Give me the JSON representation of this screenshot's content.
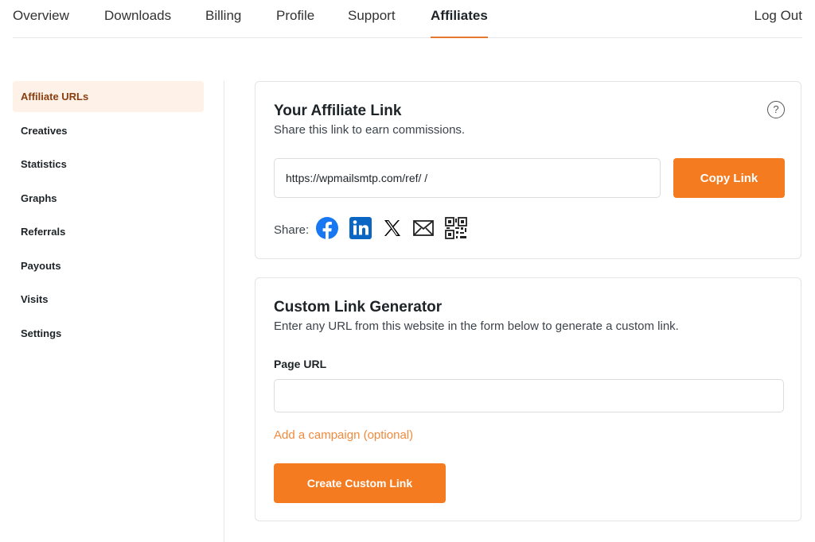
{
  "topnav": {
    "tabs": [
      {
        "label": "Overview"
      },
      {
        "label": "Downloads"
      },
      {
        "label": "Billing"
      },
      {
        "label": "Profile"
      },
      {
        "label": "Support"
      },
      {
        "label": "Affiliates",
        "active": true
      }
    ],
    "logout_label": "Log Out"
  },
  "sidebar": {
    "items": [
      {
        "label": "Affiliate URLs",
        "active": true
      },
      {
        "label": "Creatives"
      },
      {
        "label": "Statistics"
      },
      {
        "label": "Graphs"
      },
      {
        "label": "Referrals"
      },
      {
        "label": "Payouts"
      },
      {
        "label": "Visits"
      },
      {
        "label": "Settings"
      }
    ]
  },
  "affiliate_link": {
    "title": "Your Affiliate Link",
    "subtitle": "Share this link to earn commissions.",
    "help_symbol": "?",
    "url_value": "https://wpmailsmtp.com/ref/ /",
    "copy_label": "Copy Link",
    "share_label": "Share:",
    "share_icons": [
      "facebook-icon",
      "linkedin-icon",
      "x-icon",
      "email-icon",
      "qr-code-icon"
    ]
  },
  "custom_link": {
    "title": "Custom Link Generator",
    "subtitle": "Enter any URL from this website in the form below to generate a custom link.",
    "page_url_label": "Page URL",
    "page_url_value": "",
    "campaign_link": "Add a campaign (optional)",
    "create_label": "Create Custom Link"
  },
  "colors": {
    "accent": "#f47b20",
    "active_bg": "#fdf1e8",
    "active_text": "#8a3e0f",
    "facebook": "#1877f2",
    "linkedin": "#0a66c2"
  }
}
